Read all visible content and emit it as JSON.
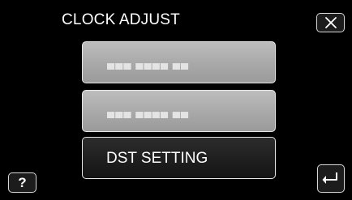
{
  "screen": {
    "title": "CLOCK ADJUST"
  },
  "menu": {
    "items": [
      {
        "label": "▄▄▄ ▄▄▄▄ ▄▄",
        "state": "disabled"
      },
      {
        "label": "▄▄▄ ▄▄▄▄ ▄▄",
        "state": "disabled"
      },
      {
        "label": "DST SETTING",
        "state": "enabled"
      }
    ]
  },
  "buttons": {
    "close_icon": "close-icon",
    "help_label": "?",
    "back_icon": "return-icon"
  },
  "colors": {
    "background": "#000000",
    "disabled_button": "#a8a8a8",
    "active_button": "#1c1c1c",
    "text": "#ffffff"
  }
}
